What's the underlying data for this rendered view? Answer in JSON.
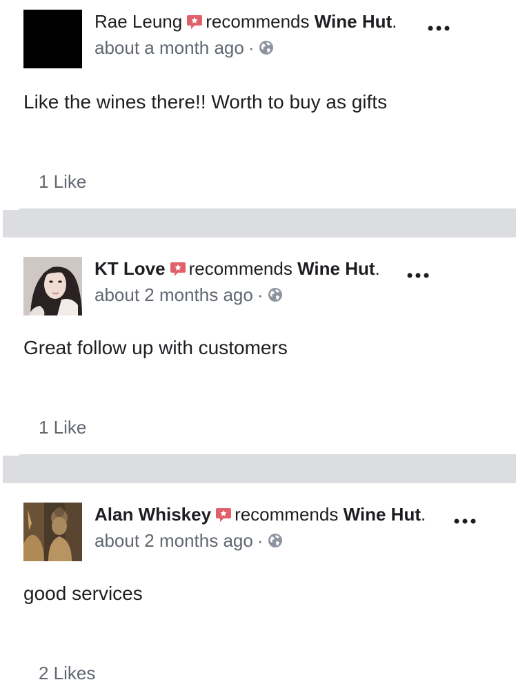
{
  "posts": [
    {
      "author": "Rae Leung",
      "author_bold": false,
      "recommends": "recommends",
      "page": "Wine Hut",
      "period": ".",
      "time": "about a month ago",
      "separator": "·",
      "text": "Like the wines there!! Worth to buy as gifts",
      "likes": "1 Like",
      "avatar": "black-square-avatar"
    },
    {
      "author": "KT Love",
      "author_bold": true,
      "recommends": "recommends",
      "page": "Wine Hut",
      "period": ".",
      "time": "about 2 months ago",
      "separator": "·",
      "text": "Great follow up with customers",
      "likes": "1 Like",
      "avatar": "portrait-photo-avatar"
    },
    {
      "author": "Alan Whiskey",
      "author_bold": true,
      "recommends": "recommends",
      "page": "Wine Hut",
      "period": ".",
      "time": "about 2 months ago",
      "separator": "·",
      "text": "good services",
      "likes": "2 Likes",
      "avatar": "buddha-statue-avatar"
    }
  ],
  "icons": {
    "recommend": "recommend-badge-icon",
    "privacy": "globe-icon",
    "more": "more-options-icon"
  },
  "colors": {
    "recommend_badge": "#e0606b",
    "secondary_text": "#606770",
    "separator_band": "#dcdde1"
  }
}
